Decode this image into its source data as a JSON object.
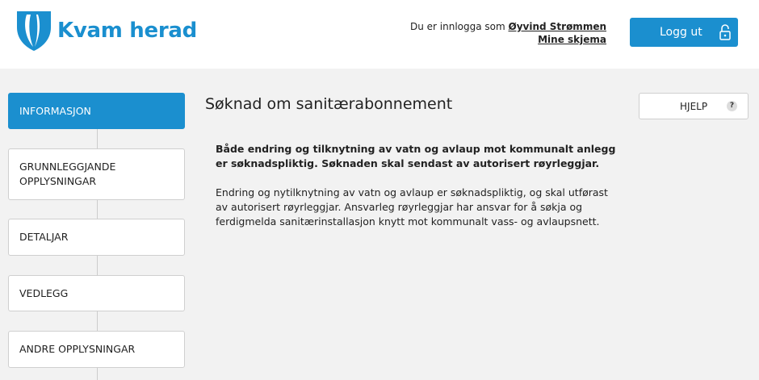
{
  "header": {
    "logo_text": "Kvam herad",
    "logged_in_prefix": "Du er innlogga som ",
    "user_name": "Øyvind Strømmen",
    "my_forms_link": "Mine skjema",
    "logout_label": "Logg ut",
    "logout_icon": "lock-open-icon"
  },
  "sidebar": {
    "items": [
      {
        "label": "INFORMASJON",
        "active": true
      },
      {
        "label": "GRUNNLEGGJANDE OPPLYSNINGAR",
        "active": false
      },
      {
        "label": "DETALJAR",
        "active": false
      },
      {
        "label": "VEDLEGG",
        "active": false
      },
      {
        "label": "ANDRE OPPLYSNINGAR",
        "active": false
      }
    ]
  },
  "main": {
    "title": "Søknad om sanitærabonnement",
    "help_label": "HJELP",
    "help_icon": "?",
    "intro_bold": "Både endring og tilknytning av vatn og avlaup mot kommunalt anlegg er søknadspliktig. Søknaden skal sendast av autorisert røyrleggjar.",
    "intro_text": "Endring og nytilknytning av vatn og avlaup er søknadspliktig, og skal utførast av autorisert røyrleggjar. Ansvarleg røyrleggjar har ansvar for å søkja og ferdigmelda sanitærinstallasjon knytt mot kommunalt vass- og avlaupsnett."
  },
  "colors": {
    "brand": "#1b8fcf",
    "background": "#f2f2f2",
    "header_bg": "#ffffff"
  }
}
